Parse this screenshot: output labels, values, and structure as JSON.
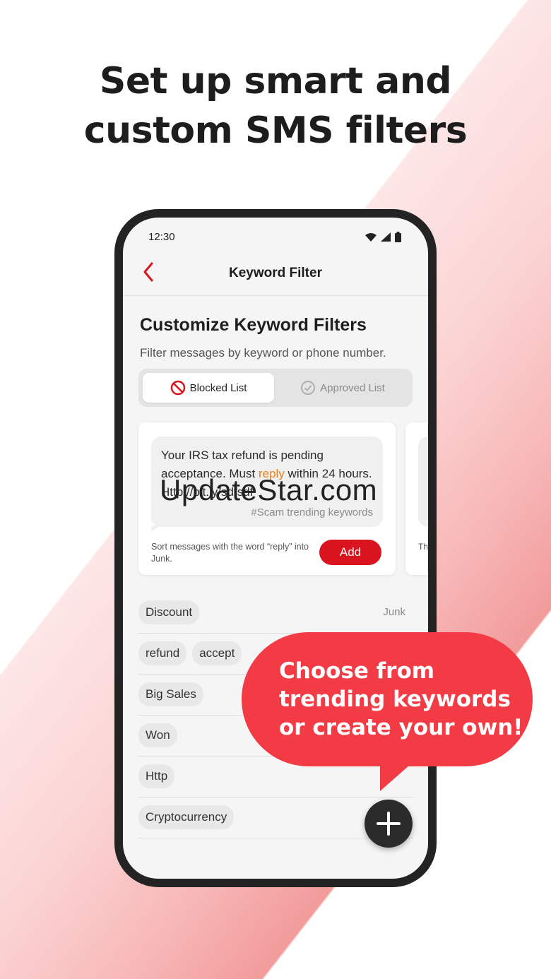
{
  "headline": {
    "line1": "Set up smart and",
    "line2": "custom SMS filters"
  },
  "status_bar": {
    "time": "12:30",
    "icons": [
      "wifi-icon",
      "cellular-signal-icon",
      "battery-icon"
    ]
  },
  "app_bar": {
    "title": "Keyword Filter",
    "back_icon": "chevron-left-icon"
  },
  "section": {
    "title": "Customize Keyword Filters",
    "subtitle": "Filter messages by keyword or phone number."
  },
  "toggle": {
    "blocked_label": "Blocked List",
    "approved_label": "Approved List",
    "selected": "Blocked List"
  },
  "suggestion_card": {
    "message_part1": "Your IRS tax refund is pending acceptance. Must ",
    "message_highlight": "reply",
    "message_part2": " within 24 hours. Http://bit.ly/sdfsdf",
    "tag": "#Scam trending keywords",
    "note": "Sort messages with the word “reply” into Junk.",
    "add_label": "Add",
    "next_card_peek": "Th wi"
  },
  "watermark": "UpdateStar.com",
  "keywords": [
    {
      "chips": [
        "Discount"
      ],
      "folder": "Junk"
    },
    {
      "chips": [
        "refund",
        "accept"
      ],
      "folder": ""
    },
    {
      "chips": [
        "Big Sales"
      ],
      "folder": ""
    },
    {
      "chips": [
        "Won"
      ],
      "folder": ""
    },
    {
      "chips": [
        "Http"
      ],
      "folder": ""
    },
    {
      "chips": [
        "Cryptocurrency"
      ],
      "folder": ""
    }
  ],
  "callout": {
    "line1": "Choose from",
    "line2": "trending keywords",
    "line3": "or create your own!"
  },
  "colors": {
    "accent_red": "#d9141e",
    "callout_red": "#f23b45",
    "highlight_orange": "#e8801e",
    "phone_frame": "#232323"
  }
}
